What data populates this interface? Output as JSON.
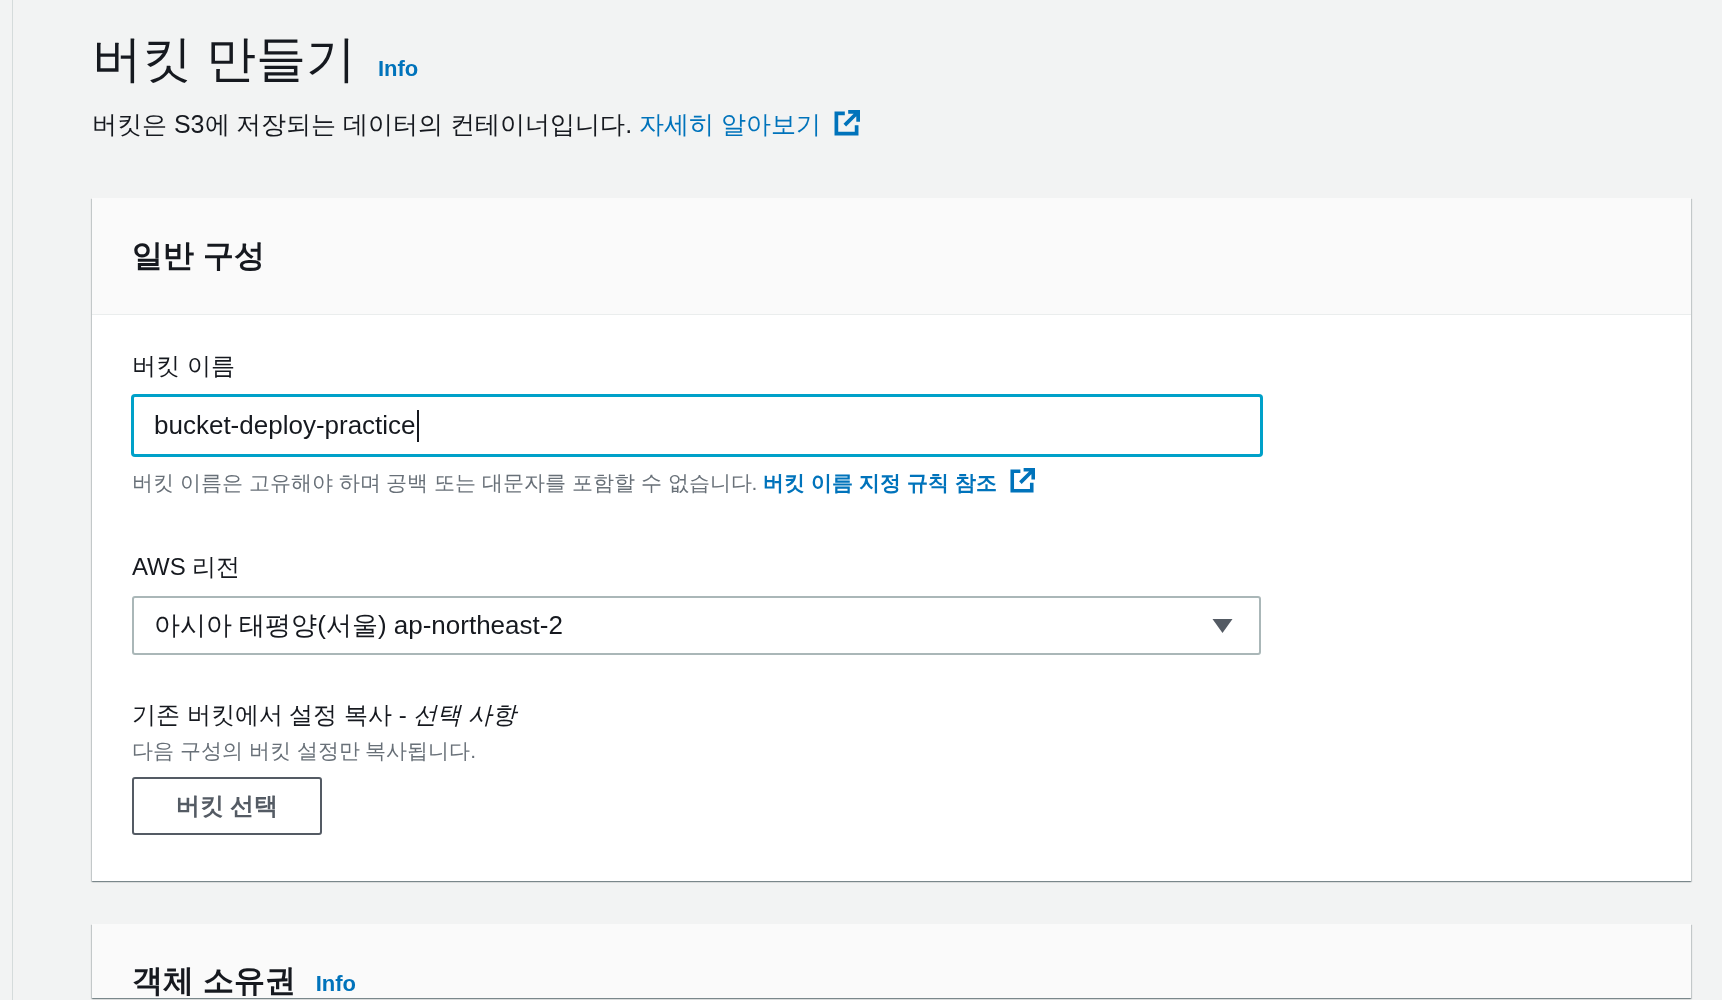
{
  "page": {
    "title": "버킷 만들기",
    "info_link": "Info",
    "description": "버킷은 S3에 저장되는 데이터의 컨테이너입니다.",
    "learn_more_link": "자세히 알아보기"
  },
  "sections": [
    {
      "title": "일반 구성",
      "fields": [
        {
          "kind": "text",
          "label": "버킷 이름",
          "value": "bucket-deploy-practice",
          "focused": true,
          "hint": "버킷 이름은 고유해야 하며 공백 또는 대문자를 포함할 수 없습니다.",
          "hint_link": "버킷 이름 지정 규칙 참조"
        },
        {
          "kind": "select",
          "label": "AWS 리전",
          "value": "아시아 태평양(서울) ap-northeast-2"
        },
        {
          "kind": "button",
          "label": "기존 버킷에서 설정 복사 - *선택 사항*",
          "description": "다음 구성의 버킷 설정만 복사됩니다.",
          "button": "버킷 선택"
        }
      ]
    },
    {
      "title": "객체 소유권",
      "info_link": "Info"
    }
  ]
}
